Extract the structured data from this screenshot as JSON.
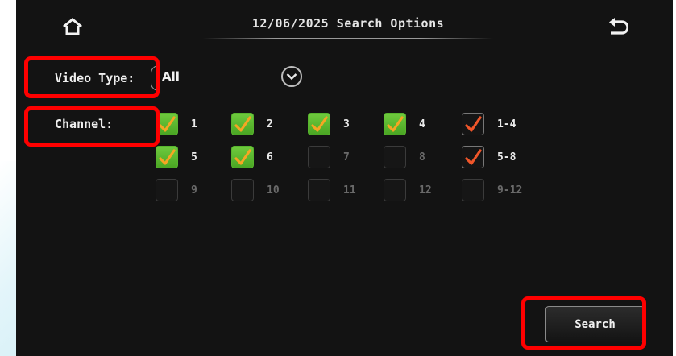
{
  "header": {
    "title": "12/06/2025 Search Options",
    "home_icon": "home-icon",
    "back_icon": "back-arrow-icon"
  },
  "video_type": {
    "label": "Video Type:",
    "value": "All",
    "dropdown_icon": "chevron-down-circle-icon"
  },
  "channel": {
    "label": "Channel:",
    "rows": [
      [
        {
          "label": "1",
          "checked": true
        },
        {
          "label": "2",
          "checked": true
        },
        {
          "label": "3",
          "checked": true
        },
        {
          "label": "4",
          "checked": true
        },
        {
          "label": "1-4",
          "checked": true,
          "group": true
        }
      ],
      [
        {
          "label": "5",
          "checked": true
        },
        {
          "label": "6",
          "checked": true
        },
        {
          "label": "7",
          "checked": false
        },
        {
          "label": "8",
          "checked": false
        },
        {
          "label": "5-8",
          "checked": true,
          "group": true
        }
      ],
      [
        {
          "label": "9",
          "checked": false
        },
        {
          "label": "10",
          "checked": false
        },
        {
          "label": "11",
          "checked": false
        },
        {
          "label": "12",
          "checked": false
        },
        {
          "label": "9-12",
          "checked": false,
          "group": true
        }
      ]
    ]
  },
  "search_button": {
    "label": "Search"
  },
  "colors": {
    "screen_bg": "#131313",
    "checked_fill": "#4aa624",
    "checkmark": "#f5a623",
    "group_checkmark": "#f0562a",
    "highlight": "#ff0000"
  }
}
